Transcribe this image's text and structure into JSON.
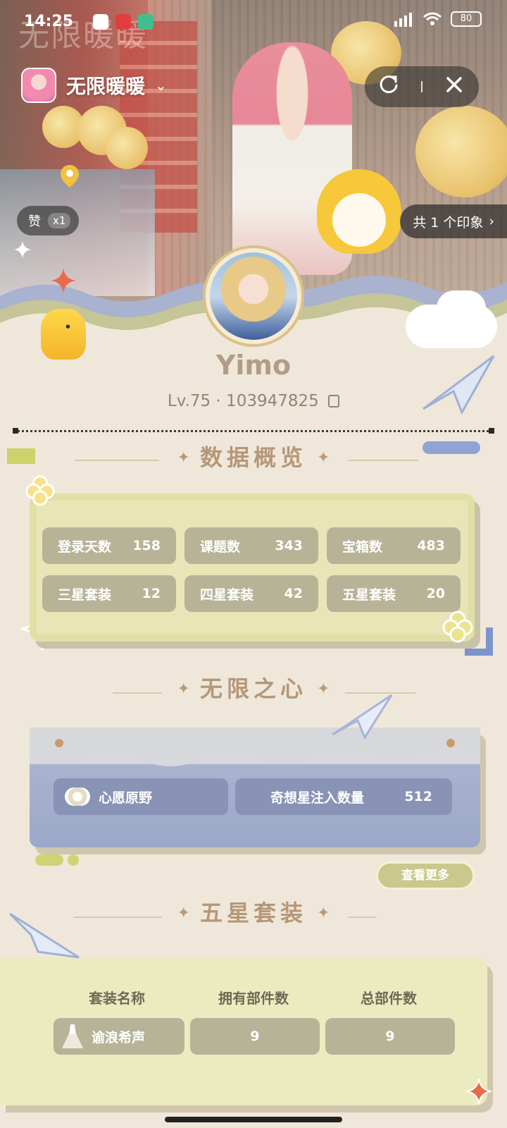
{
  "status_bar": {
    "time": "14:25",
    "battery": "80"
  },
  "header": {
    "app_name": "无限暖暖",
    "watermark": "无限暖暖"
  },
  "likes": {
    "label": "赞",
    "count": "x1"
  },
  "impressions": {
    "label": "共 1 个印象",
    "chevron": "›"
  },
  "profile": {
    "username": "Yimo",
    "level_id": "Lv.75 · 103947825"
  },
  "data_overview": {
    "title": "数据概览",
    "stats": [
      {
        "label": "登录天数",
        "value": "158"
      },
      {
        "label": "课题数",
        "value": "343"
      },
      {
        "label": "宝箱数",
        "value": "483"
      },
      {
        "label": "三星套装",
        "value": "12"
      },
      {
        "label": "四星套装",
        "value": "42"
      },
      {
        "label": "五星套装",
        "value": "20"
      }
    ]
  },
  "infinity_heart": {
    "title": "无限之心",
    "item1_label": "心愿原野",
    "item2_label": "奇想星注入数量",
    "item2_value": "512",
    "more_label": "查看更多"
  },
  "five_star": {
    "title": "五星套装",
    "columns": [
      "套装名称",
      "拥有部件数",
      "总部件数"
    ],
    "rows": [
      {
        "name": "谕浪希声",
        "owned": "9",
        "total": "9"
      }
    ]
  },
  "icons": {
    "copy": "copy-icon",
    "share": "share-icon",
    "close": "close-icon",
    "location": "location-pin-icon"
  }
}
